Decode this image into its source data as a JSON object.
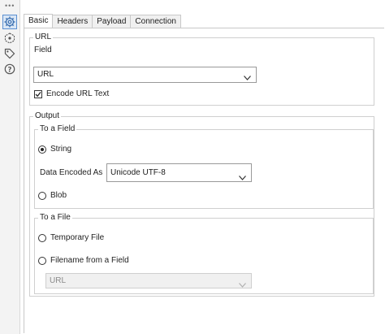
{
  "rail": {
    "grip": "•••",
    "icons": [
      "gear-icon",
      "link-icon",
      "tag-icon",
      "help-icon"
    ]
  },
  "tabs": [
    {
      "label": "Basic",
      "active": true
    },
    {
      "label": "Headers",
      "active": false
    },
    {
      "label": "Payload",
      "active": false
    },
    {
      "label": "Connection",
      "active": false
    }
  ],
  "url_section": {
    "legend": "URL",
    "field_label": "Field",
    "field_value": "URL",
    "encode_label": "Encode URL Text",
    "encode_checked": true
  },
  "output_section": {
    "legend": "Output",
    "to_field": {
      "legend": "To a Field",
      "string_label": "String",
      "string_checked": true,
      "encoding_label": "Data Encoded As",
      "encoding_value": "Unicode UTF-8",
      "blob_label": "Blob",
      "blob_checked": false
    },
    "to_file": {
      "legend": "To a File",
      "temp_label": "Temporary File",
      "temp_checked": false,
      "filename_label": "Filename from a Field",
      "filename_checked": false,
      "filename_field_value": "URL"
    }
  },
  "colors": {
    "accent": "#5b8fd1",
    "border": "#c8c8c8"
  }
}
